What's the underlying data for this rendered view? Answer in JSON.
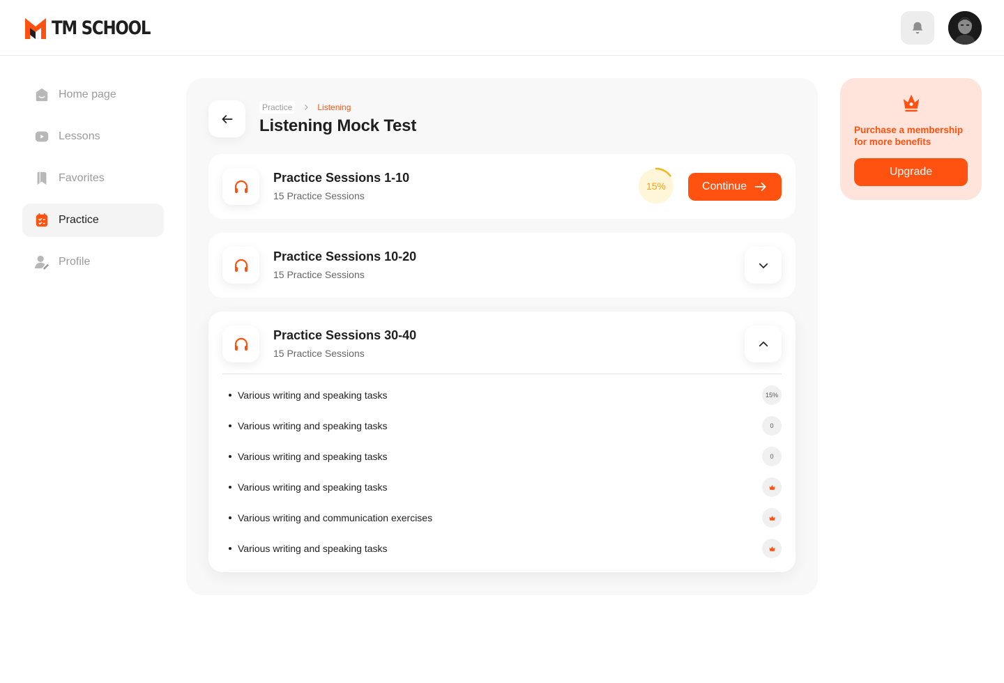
{
  "brand": {
    "name": "TM SCHOOL",
    "accent": "#ff5210"
  },
  "header": {
    "notification_icon": "bell-icon",
    "avatar_icon": "user-avatar"
  },
  "sidebar": {
    "items": [
      {
        "label": "Home page",
        "icon": "home-icon",
        "active": false
      },
      {
        "label": "Lessons",
        "icon": "play-icon",
        "active": false
      },
      {
        "label": "Favorites",
        "icon": "bookmark-icon",
        "active": false
      },
      {
        "label": "Practice",
        "icon": "checklist-icon",
        "active": true
      },
      {
        "label": "Profile",
        "icon": "user-icon",
        "active": false
      }
    ]
  },
  "main": {
    "breadcrumb": [
      "Practice",
      "Listening"
    ],
    "title": "Listening Mock Test",
    "sections": [
      {
        "title": "Practice Sessions 1-10",
        "subtitle": "15 Practice Sessions",
        "progress": 15,
        "progress_label": "15%",
        "action_label": "Continue"
      },
      {
        "title": "Practice Sessions 10-20",
        "subtitle": "15 Practice Sessions",
        "expanded": false
      },
      {
        "title": "Practice Sessions 30-40",
        "subtitle": "15 Practice Sessions",
        "expanded": true,
        "tasks": [
          {
            "label": "Various writing and speaking tasks",
            "badge": "15%"
          },
          {
            "label": "Various writing and speaking tasks",
            "badge": "0"
          },
          {
            "label": "Various writing and speaking tasks",
            "badge": "0"
          },
          {
            "label": "Various writing and speaking tasks",
            "badge_icon": "crown-icon"
          },
          {
            "label": "Various writing and communication exercises",
            "badge_icon": "crown-icon"
          },
          {
            "label": "Various writing and speaking tasks",
            "badge_icon": "crown-icon"
          }
        ]
      }
    ]
  },
  "promo": {
    "text": "Purchase a membership for more benefits",
    "button_label": "Upgrade",
    "icon": "crown-icon",
    "background": "#ffe4db"
  }
}
